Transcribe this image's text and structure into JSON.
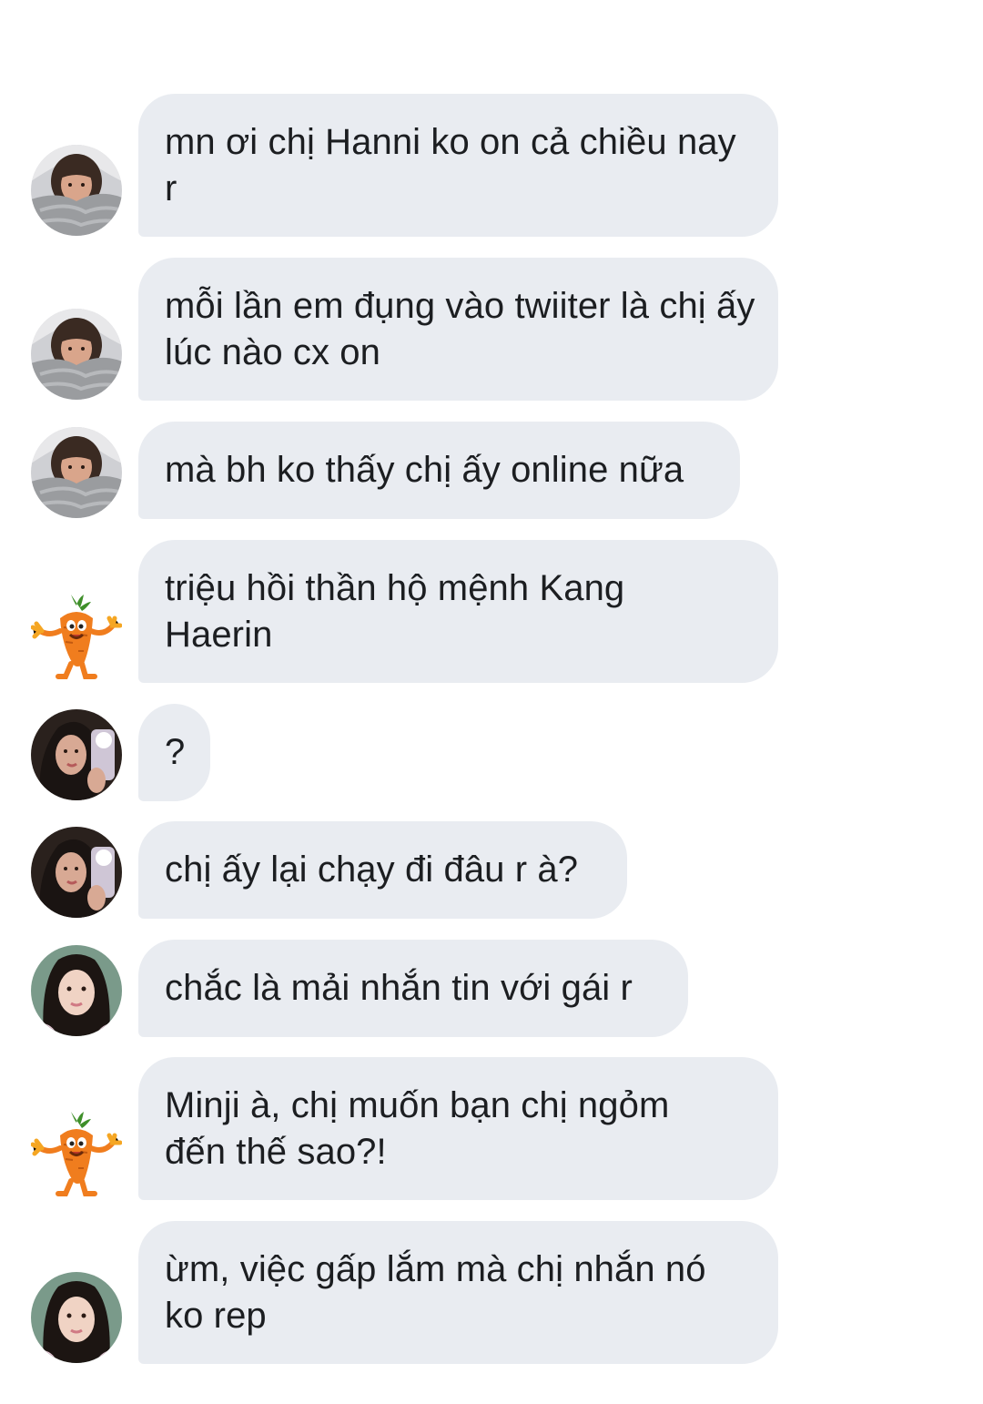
{
  "colors": {
    "bubble_background": "#e9ecf1",
    "text": "#1c1e21",
    "page_background": "#ffffff"
  },
  "messages": [
    {
      "sender_avatar": "bed-girl-avatar",
      "text": "mn ơi chị Hanni ko on cả chiều nay r"
    },
    {
      "sender_avatar": "bed-girl-avatar",
      "text": "mỗi lần em đụng vào twiiter là chị ấy lúc nào cx on"
    },
    {
      "sender_avatar": "bed-girl-avatar",
      "text": "mà bh ko thấy chị ấy online nữa"
    },
    {
      "sender_avatar": "carrot-avatar",
      "text": "triệu hồi thần hộ mệnh Kang Haerin"
    },
    {
      "sender_avatar": "mirror-selfie-avatar",
      "text": "?"
    },
    {
      "sender_avatar": "mirror-selfie-avatar",
      "text": "chị ấy lại chạy đi đâu r à?"
    },
    {
      "sender_avatar": "long-hair-girl-avatar",
      "text": "chắc là mải nhắn tin với gái r"
    },
    {
      "sender_avatar": "carrot-avatar",
      "text": "Minji à, chị muốn bạn chị ngỏm đến thế sao?!"
    },
    {
      "sender_avatar": "long-hair-girl-avatar",
      "text": "ừm, việc gấp lắm mà chị nhắn nó ko rep"
    }
  ]
}
